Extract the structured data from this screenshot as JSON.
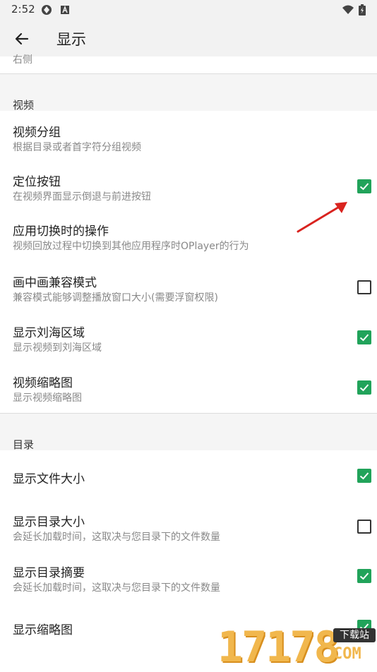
{
  "status_bar": {
    "time": "2:52"
  },
  "toolbar": {
    "title": "显示",
    "back_icon": "arrow-left-icon"
  },
  "previous_section": {
    "partial_text": "右侧"
  },
  "sections": {
    "video": {
      "header": "视频",
      "items": [
        {
          "title": "视频分组",
          "subtitle": "根据目录或者首字符分组视频"
        },
        {
          "title": "定位按钮",
          "subtitle": "在视频界面显示倒退与前进按钮",
          "checked": true
        },
        {
          "title": "应用切换时的操作",
          "subtitle": "视频回放过程中切换到其他应用程序时OPlayer的行为"
        },
        {
          "title": "画中画兼容模式",
          "subtitle": "兼容模式能够调整播放窗口大小(需要浮窗权限)",
          "checked": false
        },
        {
          "title": "显示刘海区域",
          "subtitle": "显示视频到刘海区域",
          "checked": true
        },
        {
          "title": "视频缩略图",
          "subtitle": "显示视频缩略图",
          "checked": true
        }
      ]
    },
    "directory": {
      "header": "目录",
      "items": [
        {
          "title": "显示文件大小",
          "checked": true
        },
        {
          "title": "显示目录大小",
          "subtitle": "会延长加载时间，这取决与您目录下的文件数量",
          "checked": false
        },
        {
          "title": "显示目录摘要",
          "subtitle": "会延长加载时间，这取决与您目录下的文件数量",
          "checked": true
        },
        {
          "title": "显示缩略图",
          "checked": true
        }
      ]
    }
  },
  "colors": {
    "accent": "#21a35a",
    "arrow": "#d9231f",
    "header_bg": "#f2f2f2"
  },
  "watermark": {
    "number": "17178",
    "tag": "下载站",
    "suffix": "COM"
  }
}
